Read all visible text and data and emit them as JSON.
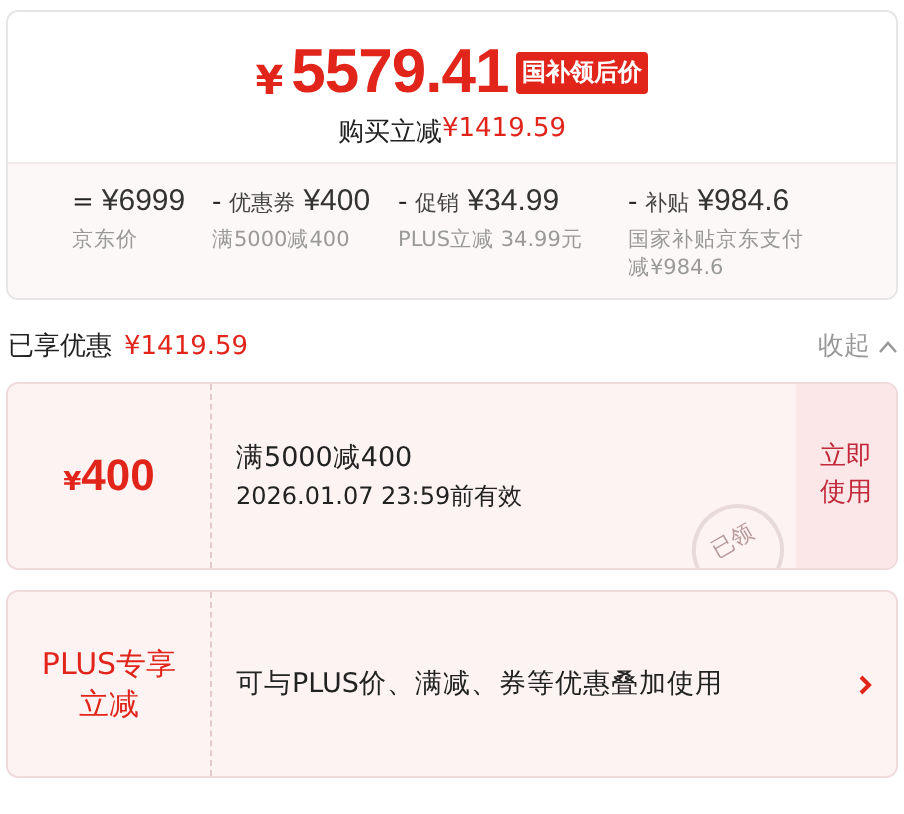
{
  "summary": {
    "currency": "¥",
    "price": "5579.41",
    "badge": "国补领后价",
    "saving_label": "购买立减",
    "saving_amount": "¥1419.59",
    "breakdown": [
      {
        "op": "=",
        "amount": "¥6999",
        "note": "京东价"
      },
      {
        "op": "-",
        "label": "优惠券",
        "amount": "¥400",
        "note": "满5000减400"
      },
      {
        "op": "-",
        "label": "促销",
        "amount": "¥34.99",
        "note": "PLUS立减 34.99元"
      },
      {
        "op": "-",
        "label": "补贴",
        "amount": "¥984.6",
        "note": "国家补贴京东支付减¥984.6"
      }
    ]
  },
  "enjoyed": {
    "label": "已享优惠",
    "amount": "¥1419.59",
    "toggle": "收起",
    "expanded": true
  },
  "offers": [
    {
      "kind": "coupon",
      "currency": "¥",
      "value": "400",
      "title": "满5000减400",
      "validity": "2026.01.07 23:59前有效",
      "action": "立即使用",
      "stamp": "已领"
    },
    {
      "kind": "plus",
      "value": "PLUS专享立减",
      "title": "可与PLUS价、满减、券等优惠叠加使用"
    }
  ]
}
